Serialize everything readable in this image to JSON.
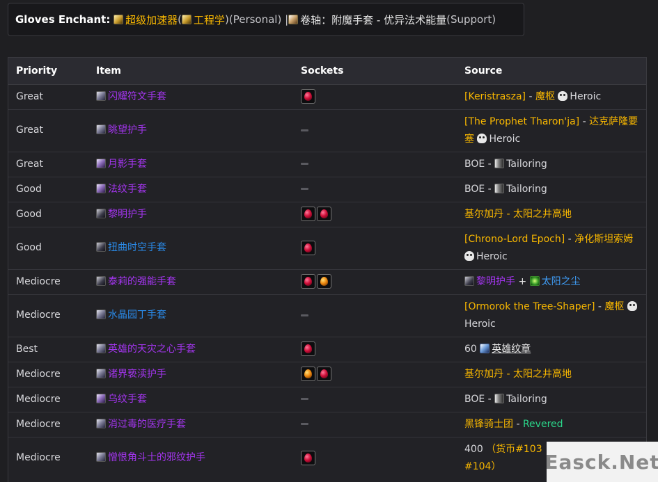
{
  "enchant": {
    "label": "Gloves Enchant:",
    "primary": "超级加速器",
    "paren_open": " (",
    "profession": "工程学",
    "paren_close": ")",
    "personal": " (Personal) | ",
    "scroll": "卷轴：附魔手套 - 优异法术能量",
    "support": " (Support)"
  },
  "table": {
    "headers": {
      "priority": "Priority",
      "item": "Item",
      "sockets": "Sockets",
      "source": "Source"
    },
    "rows": [
      {
        "priority": "Great",
        "item": "闪耀符文手套",
        "source": {
          "a": "[Keristrasza]",
          "sep": " - ",
          "b": "魔枢",
          "heroic": "Heroic"
        }
      },
      {
        "priority": "Great",
        "item": "眺望护手",
        "source": {
          "a": "[The Prophet Tharon'ja]",
          "sep": " - ",
          "b": "达克萨隆要塞",
          "heroic": "Heroic"
        }
      },
      {
        "priority": "Great",
        "item": "月影手套",
        "source": {
          "boe": "BOE - ",
          "prof": "Tailoring"
        }
      },
      {
        "priority": "Good",
        "item": "法纹手套",
        "source": {
          "boe": "BOE - ",
          "prof": "Tailoring"
        }
      },
      {
        "priority": "Good",
        "item": "黎明护手",
        "source": {
          "a": "基尔加丹",
          "sep": " - ",
          "b": "太阳之井高地"
        }
      },
      {
        "priority": "Good",
        "item": "扭曲时空手套",
        "source": {
          "a": "[Chrono-Lord Epoch]",
          "sep": " - ",
          "b": "净化斯坦索姆",
          "heroic": "Heroic"
        }
      },
      {
        "priority": "Mediocre",
        "item": "泰莉的强能手套",
        "source": {
          "a": "黎明护手",
          "plus": " + ",
          "b": "太阳之尘"
        }
      },
      {
        "priority": "Mediocre",
        "item": "水晶园丁手套",
        "source": {
          "a": "[Ormorok the Tree-Shaper]",
          "sep": " - ",
          "b": "魔枢",
          "heroic": "Heroic"
        }
      },
      {
        "priority": "Best",
        "item": "英雄的天灾之心手套",
        "source": {
          "count": "60 ",
          "badge": "英雄纹章"
        }
      },
      {
        "priority": "Mediocre",
        "item": "诸界亵渎护手",
        "source": {
          "a": "基尔加丹",
          "sep": " - ",
          "b": "太阳之井高地"
        }
      },
      {
        "priority": "Mediocre",
        "item": "乌纹手套",
        "source": {
          "boe": "BOE - ",
          "prof": "Tailoring"
        }
      },
      {
        "priority": "Mediocre",
        "item": "消过毒的医疗手套",
        "source": {
          "a": "黑锋骑士团",
          "sep": " - ",
          "rep": "Revered"
        }
      },
      {
        "priority": "Mediocre",
        "item": "憎恨角斗士的邪纹护手",
        "source": {
          "count": "400 ",
          "currency": "（货币#103",
          "currency2": "#104）"
        }
      }
    ]
  },
  "watermark": "Easck.Net"
}
